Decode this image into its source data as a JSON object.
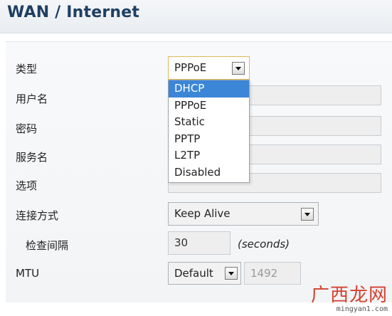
{
  "header": {
    "title": "WAN / Internet"
  },
  "form": {
    "type_label": "类型",
    "type_value": "PPPoE",
    "username_label": "用户名",
    "password_label": "密码",
    "service_label": "服务名",
    "options_label": "选项",
    "connect_mode_label": "连接方式",
    "connect_mode_value": "Keep Alive",
    "check_interval_label": "检查间隔",
    "check_interval_value": "30",
    "check_interval_unit": "(seconds)",
    "mtu_label": "MTU",
    "mtu_mode_value": "Default",
    "mtu_value": "1492"
  },
  "dropdown": {
    "options": [
      "DHCP",
      "PPPoE",
      "Static",
      "PPTP",
      "L2TP",
      "Disabled"
    ],
    "highlighted": "DHCP"
  },
  "watermark": {
    "text": "广西龙网",
    "url": "mingyan1.com"
  },
  "icons": {
    "dropdown_arrow": "chevron-down-icon"
  },
  "colors": {
    "highlight": "#3b86d6",
    "title": "#1f3f62",
    "watermark": "#d4412f"
  }
}
